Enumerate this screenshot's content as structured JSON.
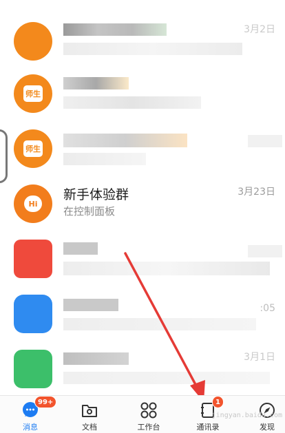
{
  "chats": [
    {
      "avatar_color": "#f3891c",
      "time": "3月2日"
    },
    {
      "avatar_color": "#f3891c",
      "avatar_text": "师生"
    },
    {
      "avatar_color": "#f3891c",
      "avatar_text": "师生"
    },
    {
      "avatar_color": "#f27d1c",
      "avatar_text": "Hi",
      "title": "新手体验群",
      "subtitle": "在控制面板",
      "time": "3月23日"
    },
    {
      "avatar_color": "#ef4a3c"
    },
    {
      "avatar_color": "#2f8bf0",
      "time": ":05"
    },
    {
      "avatar_color": "#3cbf6a",
      "time": "3月1日"
    }
  ],
  "tabbar": {
    "messages": {
      "label": "消息",
      "badge": "99+"
    },
    "docs": {
      "label": "文档"
    },
    "workbench": {
      "label": "工作台"
    },
    "contacts": {
      "label": "通讯录",
      "badge": "1"
    },
    "discover": {
      "label": "发现"
    }
  },
  "watermark": "jingyan.baidu.com",
  "colors": {
    "accent": "#1d7cf2",
    "badge": "#f2542d",
    "arrow": "#e53b36"
  }
}
